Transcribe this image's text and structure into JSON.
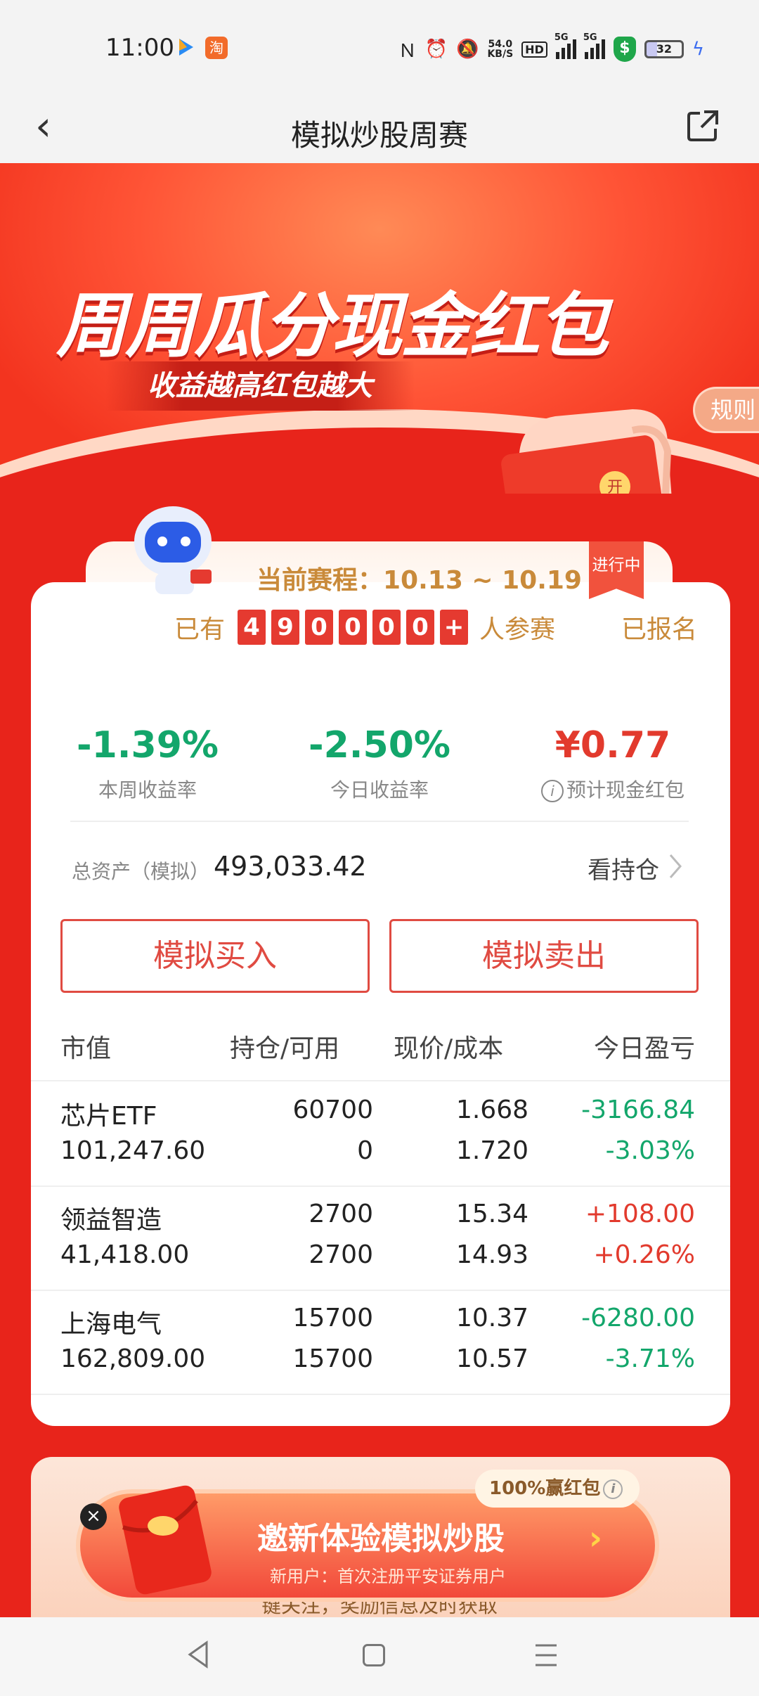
{
  "status_bar": {
    "time": "11:00",
    "taobao_label": "淘",
    "net_speed_value": "54.0",
    "net_speed_unit": "KB/S",
    "hd_label": "HD",
    "sig1_label": "5G",
    "sig2_label": "5G",
    "battery": "32",
    "icons": [
      "nfc-icon",
      "alarm-icon",
      "mute-icon",
      "hd-icon",
      "signal-icon",
      "signal-icon",
      "security-shield-icon",
      "battery-icon",
      "charging-icon"
    ]
  },
  "nav": {
    "title": "模拟炒股周赛"
  },
  "banner": {
    "title": "周周瓜分现金红包",
    "subtitle": "收益越高红包越大",
    "rules_label": "规则",
    "envelope_char": "开"
  },
  "contest": {
    "round_label": "当前赛程：10.13 ~ 10.19",
    "status": "进行中",
    "participants_prefix": "已有",
    "participant_digits": [
      "4",
      "9",
      "0",
      "0",
      "0",
      "0",
      "+"
    ],
    "participants_suffix": "人参赛",
    "registered": "已报名"
  },
  "stats": [
    {
      "value": "-1.39%",
      "label": "本周收益率"
    },
    {
      "value": "-2.50%",
      "label": "今日收益率"
    },
    {
      "value": "¥0.77",
      "label": "预计现金红包"
    }
  ],
  "assets": {
    "label": "总资产（模拟）",
    "value": "493,033.42",
    "holdings_link": "看持仓"
  },
  "actions": {
    "buy": "模拟买入",
    "sell": "模拟卖出"
  },
  "table": {
    "headers": [
      "市值",
      "持仓/可用",
      "现价/成本",
      "今日盈亏"
    ],
    "rows": [
      {
        "name": "芯片ETF",
        "market_value": "101,247.60",
        "holding": "60700",
        "available": "0",
        "price": "1.668",
        "cost": "1.720",
        "pnl": "-3166.84",
        "pnl_pct": "-3.03%",
        "trend": "down"
      },
      {
        "name": "领益智造",
        "market_value": "41,418.00",
        "holding": "2700",
        "available": "2700",
        "price": "15.34",
        "cost": "14.93",
        "pnl": "+108.00",
        "pnl_pct": "+0.26%",
        "trend": "up"
      },
      {
        "name": "上海电气",
        "market_value": "162,809.00",
        "holding": "15700",
        "available": "15700",
        "price": "10.37",
        "cost": "10.57",
        "pnl": "-6280.00",
        "pnl_pct": "-3.71%",
        "trend": "down"
      }
    ]
  },
  "promo": {
    "badge": "100%赢红包",
    "title": "邀新体验模拟炒股",
    "subtitle": "新用户：首次注册平安证券用户",
    "below_text": "键关注，奖励信息及时获取",
    "close_label": "×",
    "chevron": "›"
  },
  "colors": {
    "up": "#e23a2d",
    "down": "#13a66b",
    "accent": "#e8241b",
    "gold": "#c98a3a"
  }
}
